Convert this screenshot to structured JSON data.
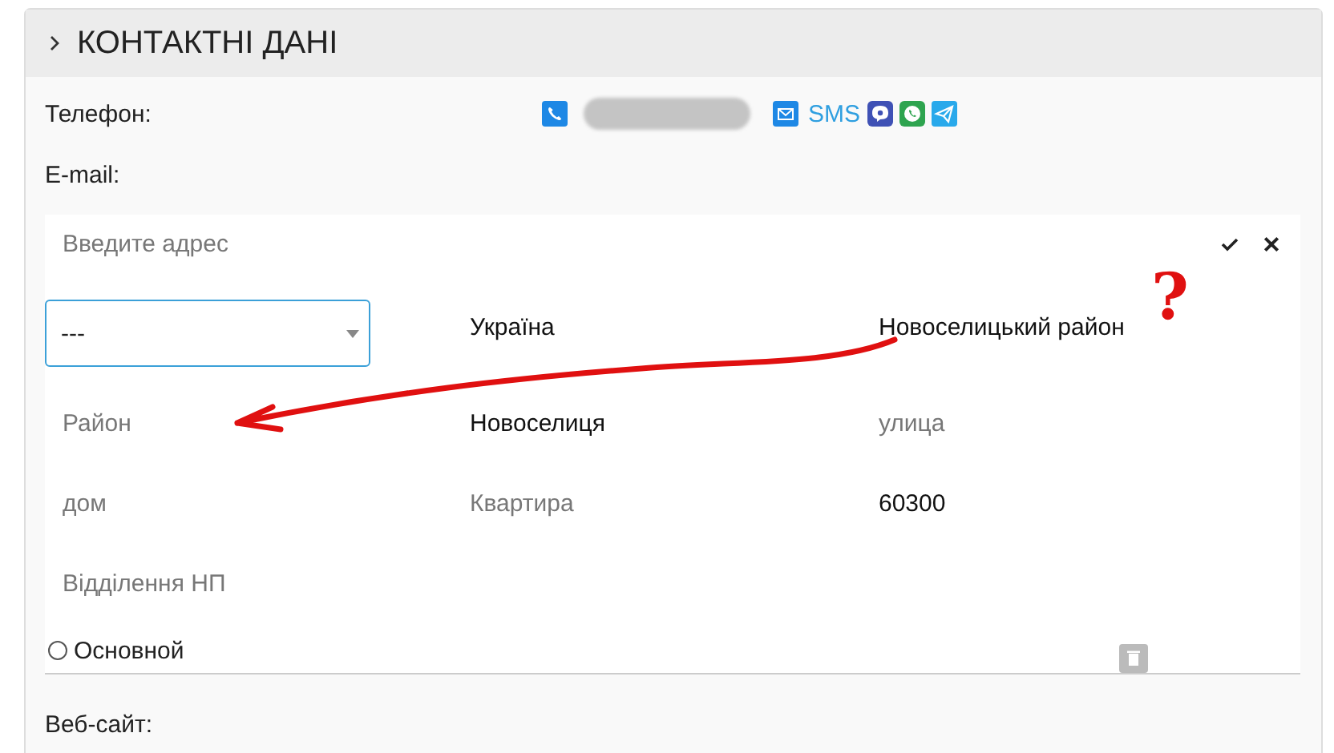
{
  "section": {
    "title": "КОНТАКТНІ ДАНІ",
    "expanded": true
  },
  "phone": {
    "label": "Телефон:",
    "sms": "SMS"
  },
  "email": {
    "label": "E-mail:"
  },
  "address": {
    "placeholder": "Введите адрес",
    "fields": [
      {
        "kind": "select",
        "value": "---"
      },
      {
        "kind": "text",
        "value": "Україна"
      },
      {
        "kind": "text",
        "value": "Новоселицький район"
      },
      {
        "kind": "input",
        "placeholder": "Район"
      },
      {
        "kind": "text",
        "value": "Новоселиця"
      },
      {
        "kind": "input",
        "placeholder": "улица"
      },
      {
        "kind": "input",
        "placeholder": "дом"
      },
      {
        "kind": "input",
        "placeholder": "Квартира"
      },
      {
        "kind": "text",
        "value": "60300"
      },
      {
        "kind": "input",
        "placeholder": "Відділення НП"
      }
    ],
    "primary": {
      "label": "Основной",
      "checked": false
    }
  },
  "website": {
    "label": "Веб-сайт:"
  },
  "annotation": {
    "mark": "?"
  }
}
